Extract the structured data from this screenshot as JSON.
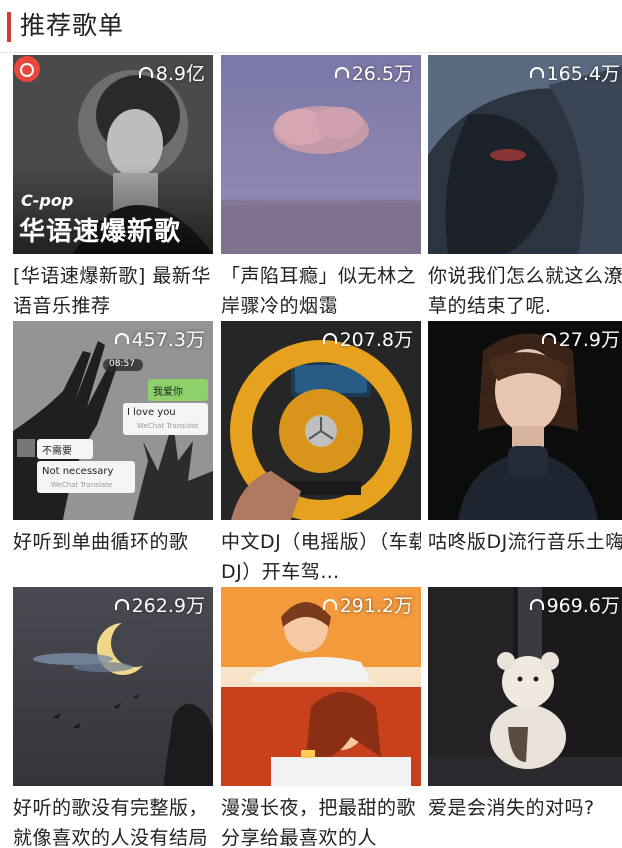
{
  "header": {
    "title": "推荐歌单"
  },
  "playlists": [
    {
      "count": "8.9亿",
      "title": "[华语速爆新歌] 最新华语音乐推荐",
      "cover_tag": "C-pop",
      "cover_title": "华语速爆新歌"
    },
    {
      "count": "26.5万",
      "title": "「声陷耳瘾」似无林之岸骤冷的烟霭"
    },
    {
      "count": "165.4万",
      "title": "你说我们怎么就这么潦草的结束了呢."
    },
    {
      "count": "457.3万",
      "title": "好听到单曲循环的歌",
      "chat": {
        "time": "08:57",
        "bubble1": "我爱你",
        "bubble2": "I love you",
        "bubble3": "不需要",
        "bubble4": "Not necessary",
        "translate_note": "WeChat Translate"
      }
    },
    {
      "count": "207.8万",
      "title": "中文DJ（电摇版）（车载DJ）开车驾…"
    },
    {
      "count": "27.9万",
      "title": "咕咚版DJ流行音乐土嗨"
    },
    {
      "count": "262.9万",
      "title": "好听的歌没有完整版，就像喜欢的人没有结局"
    },
    {
      "count": "291.2万",
      "title": "漫漫长夜，把最甜的歌分享给最喜欢的人"
    },
    {
      "count": "969.6万",
      "title": "爱是会消失的对吗?"
    }
  ],
  "colors": {
    "accent": "#d43c33",
    "text": "#222222"
  }
}
